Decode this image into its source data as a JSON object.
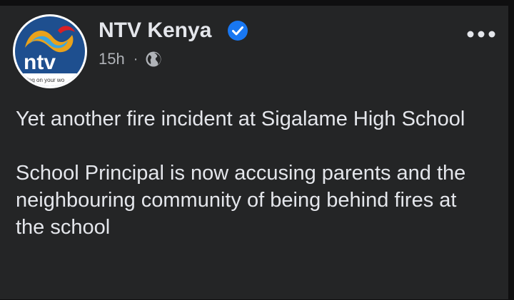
{
  "post": {
    "page_name": "NTV Kenya",
    "timestamp": "15h",
    "separator": "·",
    "avatar": {
      "brand": "ntv",
      "tagline": "turning on your world"
    },
    "icons": {
      "verified": "verified-badge-icon",
      "audience": "globe-icon",
      "menu": "more-options-icon"
    },
    "paragraphs": [
      "Yet another fire incident at Sigalame High School",
      "School Principal is now accusing parents and the neighbouring community of being behind fires at the school"
    ]
  },
  "colors": {
    "card_background": "#242526",
    "text_primary": "#e4e6eb",
    "text_secondary": "#b0b3b8",
    "verified_blue": "#1877f2",
    "ntv_red": "#d91f26"
  }
}
